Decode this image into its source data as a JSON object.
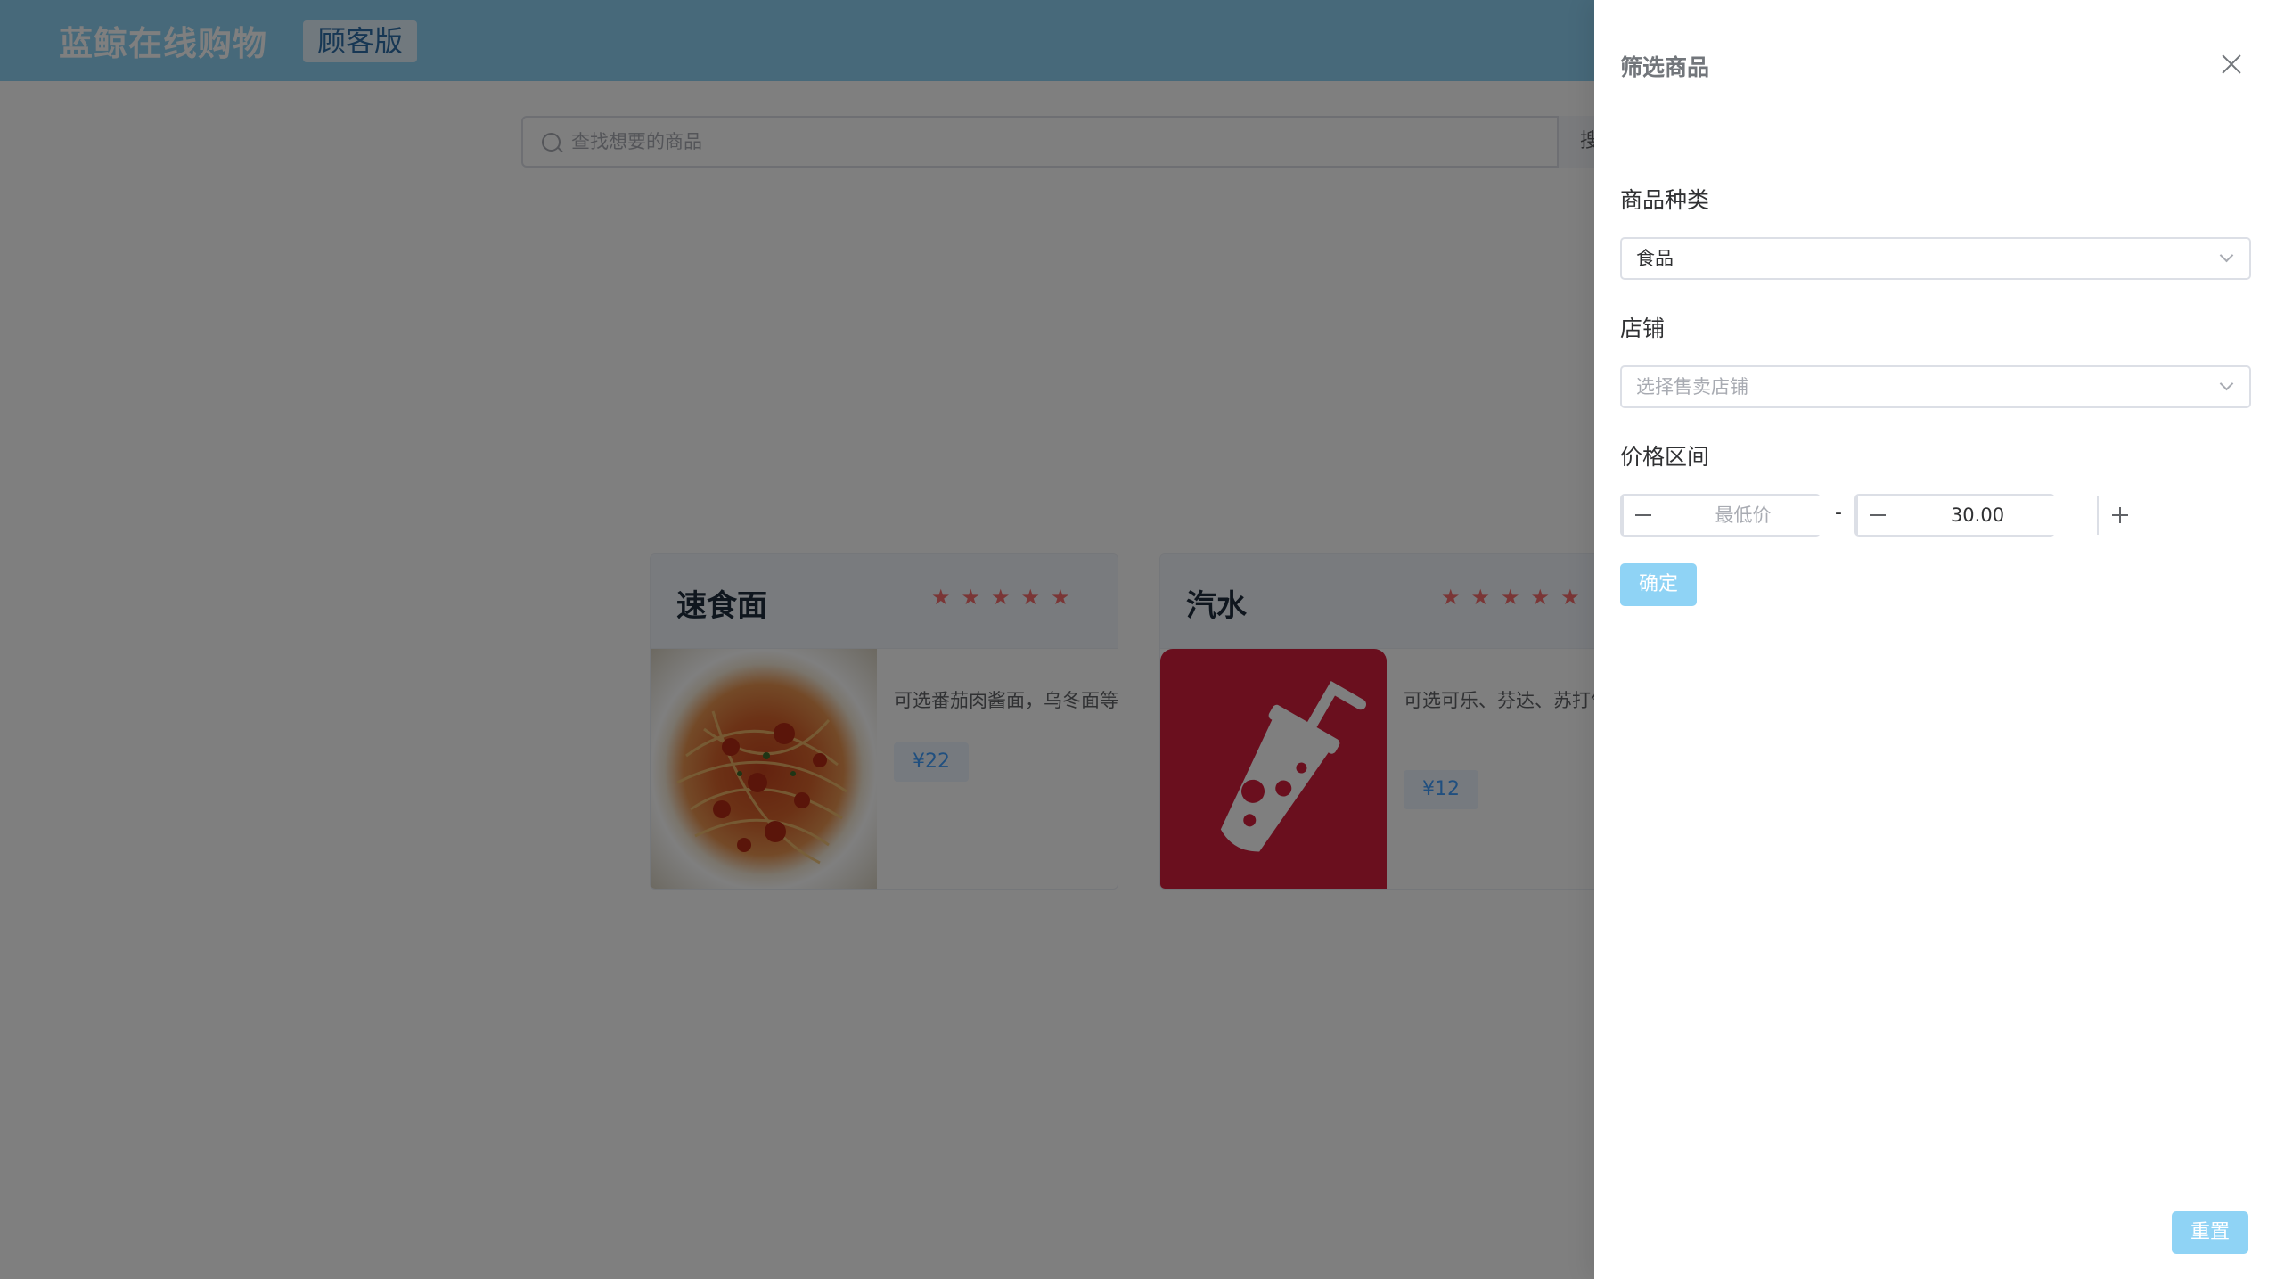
{
  "header": {
    "brand": "蓝鲸在线购物",
    "edition": "顾客版"
  },
  "search": {
    "placeholder": "查找想要的商品",
    "button_label": "搜"
  },
  "products": [
    {
      "name": "速食面",
      "rating": 5,
      "description": "可选番茄肉酱面，乌冬面等",
      "price": "¥22",
      "image": "spaghetti-photo"
    },
    {
      "name": "汽水",
      "rating": 5,
      "description": "可选可乐、芬达、苏打气水",
      "price": "¥12",
      "image": "soda-cup-icon"
    }
  ],
  "drawer": {
    "title": "筛选商品",
    "category": {
      "label": "商品种类",
      "value": "食品"
    },
    "shop": {
      "label": "店铺",
      "placeholder": "选择售卖店铺"
    },
    "price_range": {
      "label": "价格区间",
      "min_placeholder": "最低价",
      "separator": "-",
      "max_value": "30.00"
    },
    "confirm_label": "确定",
    "reset_label": "重置"
  },
  "colors": {
    "accent": "#8fd3f5",
    "star": "#f56c6c",
    "price_text": "#409eff",
    "soda_bg": "#d41f3d"
  }
}
